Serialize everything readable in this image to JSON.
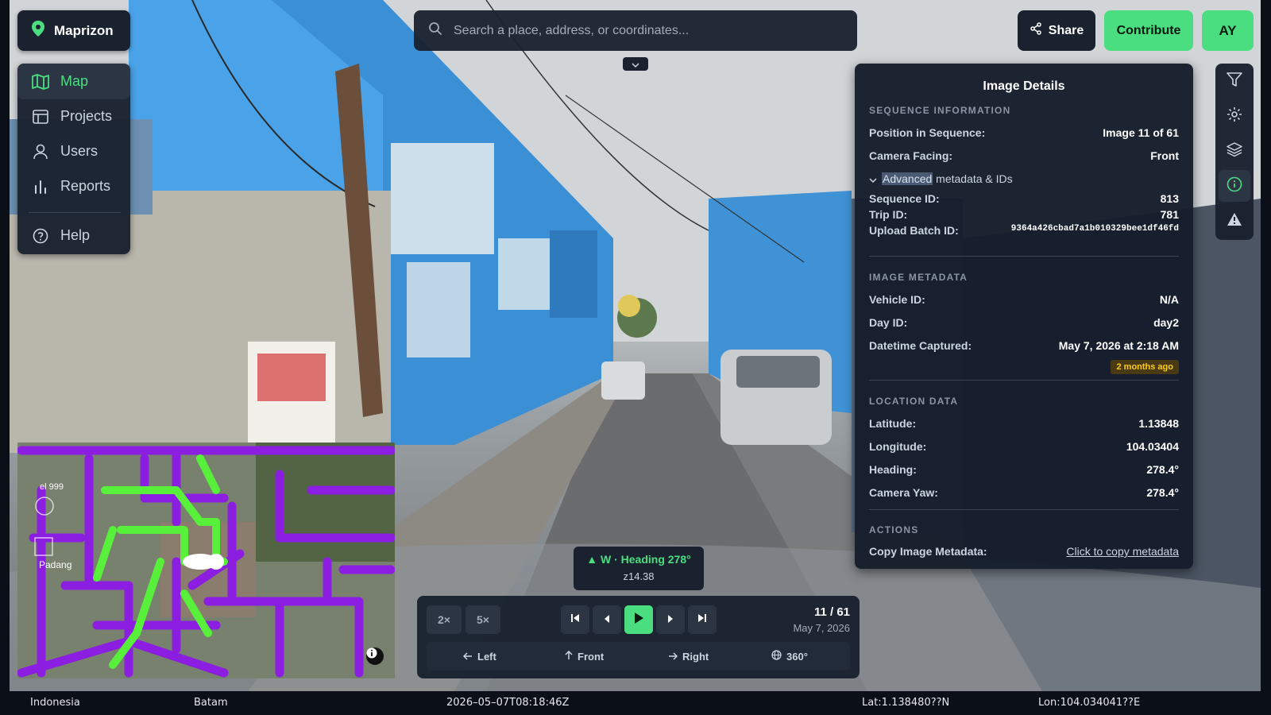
{
  "app": {
    "name": "Maprizon"
  },
  "sidebar": {
    "items": [
      {
        "label": "Map",
        "icon": "map-icon",
        "active": true
      },
      {
        "label": "Projects",
        "icon": "table-icon",
        "active": false
      },
      {
        "label": "Users",
        "icon": "user-icon",
        "active": false
      },
      {
        "label": "Reports",
        "icon": "bar-chart-icon",
        "active": false
      },
      {
        "label": "Help",
        "icon": "help-circle-icon",
        "active": false
      }
    ]
  },
  "search": {
    "placeholder": "Search a place, address, or coordinates..."
  },
  "header": {
    "share_label": "Share",
    "contribute_label": "Contribute",
    "avatar_initials": "AY"
  },
  "rail": {
    "icons": [
      "filter-icon",
      "gear-icon",
      "layers-icon",
      "info-icon",
      "warning-icon"
    ],
    "active": "info-icon"
  },
  "details": {
    "title": "Image Details",
    "sequence": {
      "heading": "SEQUENCE INFORMATION",
      "position_label": "Position in Sequence:",
      "position_value": "Image 11 of 61",
      "facing_label": "Camera Facing:",
      "facing_value": "Front"
    },
    "advanced": {
      "toggle_highlight": "Advanced",
      "toggle_rest": " metadata & IDs",
      "sequence_id_label": "Sequence ID:",
      "sequence_id_value": "813",
      "trip_id_label": "Trip ID:",
      "trip_id_value": "781",
      "batch_label": "Upload Batch ID:",
      "batch_value": "9364a426cbad7a1b010329bee1df46fd"
    },
    "image_meta": {
      "heading": "IMAGE METADATA",
      "vehicle_label": "Vehicle ID:",
      "vehicle_value": "N/A",
      "day_label": "Day ID:",
      "day_value": "day2",
      "datetime_label": "Datetime Captured:",
      "datetime_value": "May 7, 2026 at 2:18 AM",
      "ago_badge": "2 months ago"
    },
    "location": {
      "heading": "LOCATION DATA",
      "lat_label": "Latitude:",
      "lat_value": "1.13848",
      "lon_label": "Longitude:",
      "lon_value": "104.03404",
      "heading_label": "Heading:",
      "heading_value": "278.4°",
      "yaw_label": "Camera Yaw:",
      "yaw_value": "278.4°"
    },
    "actions": {
      "heading": "ACTIONS",
      "copy_label": "Copy Image Metadata:",
      "copy_link": "Click to copy metadata"
    }
  },
  "minimap": {
    "place_label": "Padang",
    "street_label": "el 999"
  },
  "heading_tip": {
    "line1": "▲ W · Heading 278°",
    "line2": "z14.38"
  },
  "player": {
    "speeds": [
      "2×",
      "5×"
    ],
    "counter": "11 / 61",
    "date": "May 7, 2026",
    "directions": [
      {
        "label": "Left",
        "icon": "arrow-left-icon"
      },
      {
        "label": "Front",
        "icon": "arrow-up-icon"
      },
      {
        "label": "Right",
        "icon": "arrow-right-icon"
      },
      {
        "label": "360°",
        "icon": "globe-icon"
      }
    ]
  },
  "status": {
    "country": "Indonesia",
    "city": "Batam",
    "timestamp": "2026–05–07T08:18:46Z",
    "lat": "Lat:1.138480??N",
    "lon": "Lon:104.034041??E"
  },
  "colors": {
    "accent": "#4ade80",
    "panel": "#1a2230",
    "route_purple": "#8b1ee0",
    "route_green": "#59f03c"
  }
}
